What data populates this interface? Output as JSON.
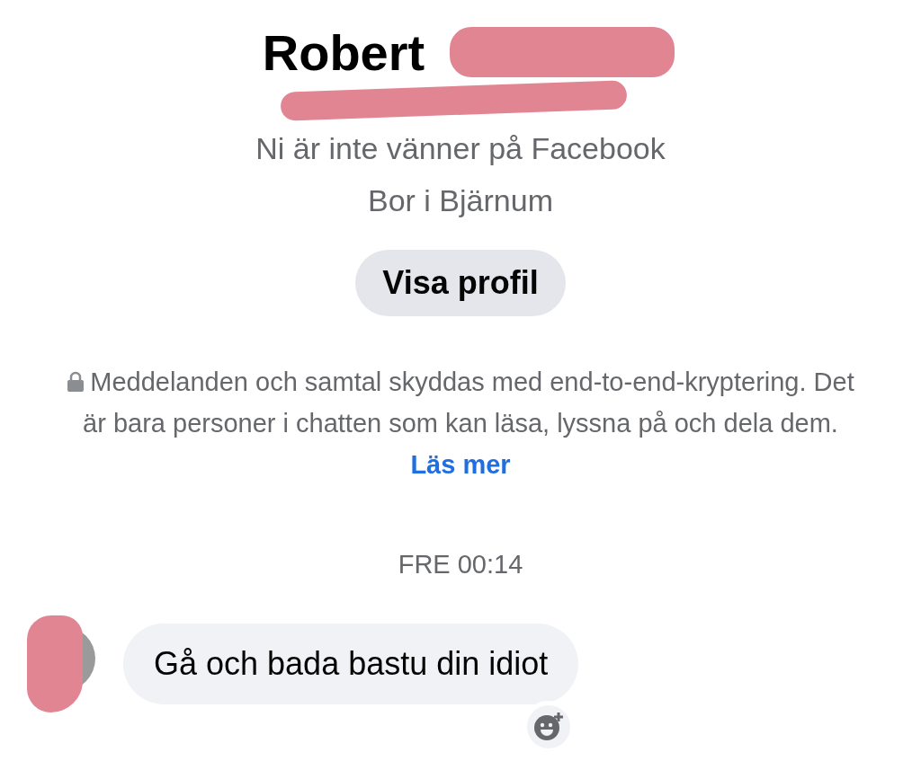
{
  "profile": {
    "name": "Robert",
    "friendship": "Ni är inte vänner på Facebook",
    "location": "Bor i Bjärnum",
    "button": "Visa profil"
  },
  "encryption": {
    "text": "Meddelanden och samtal skyddas med end-to-end-kryptering. Det är bara personer i chatten som kan läsa, lyssna på och dela dem.",
    "link": "Läs mer"
  },
  "timestamp": "FRE 00:14",
  "messages": [
    {
      "text": "Gå och bada bastu din idiot"
    }
  ]
}
